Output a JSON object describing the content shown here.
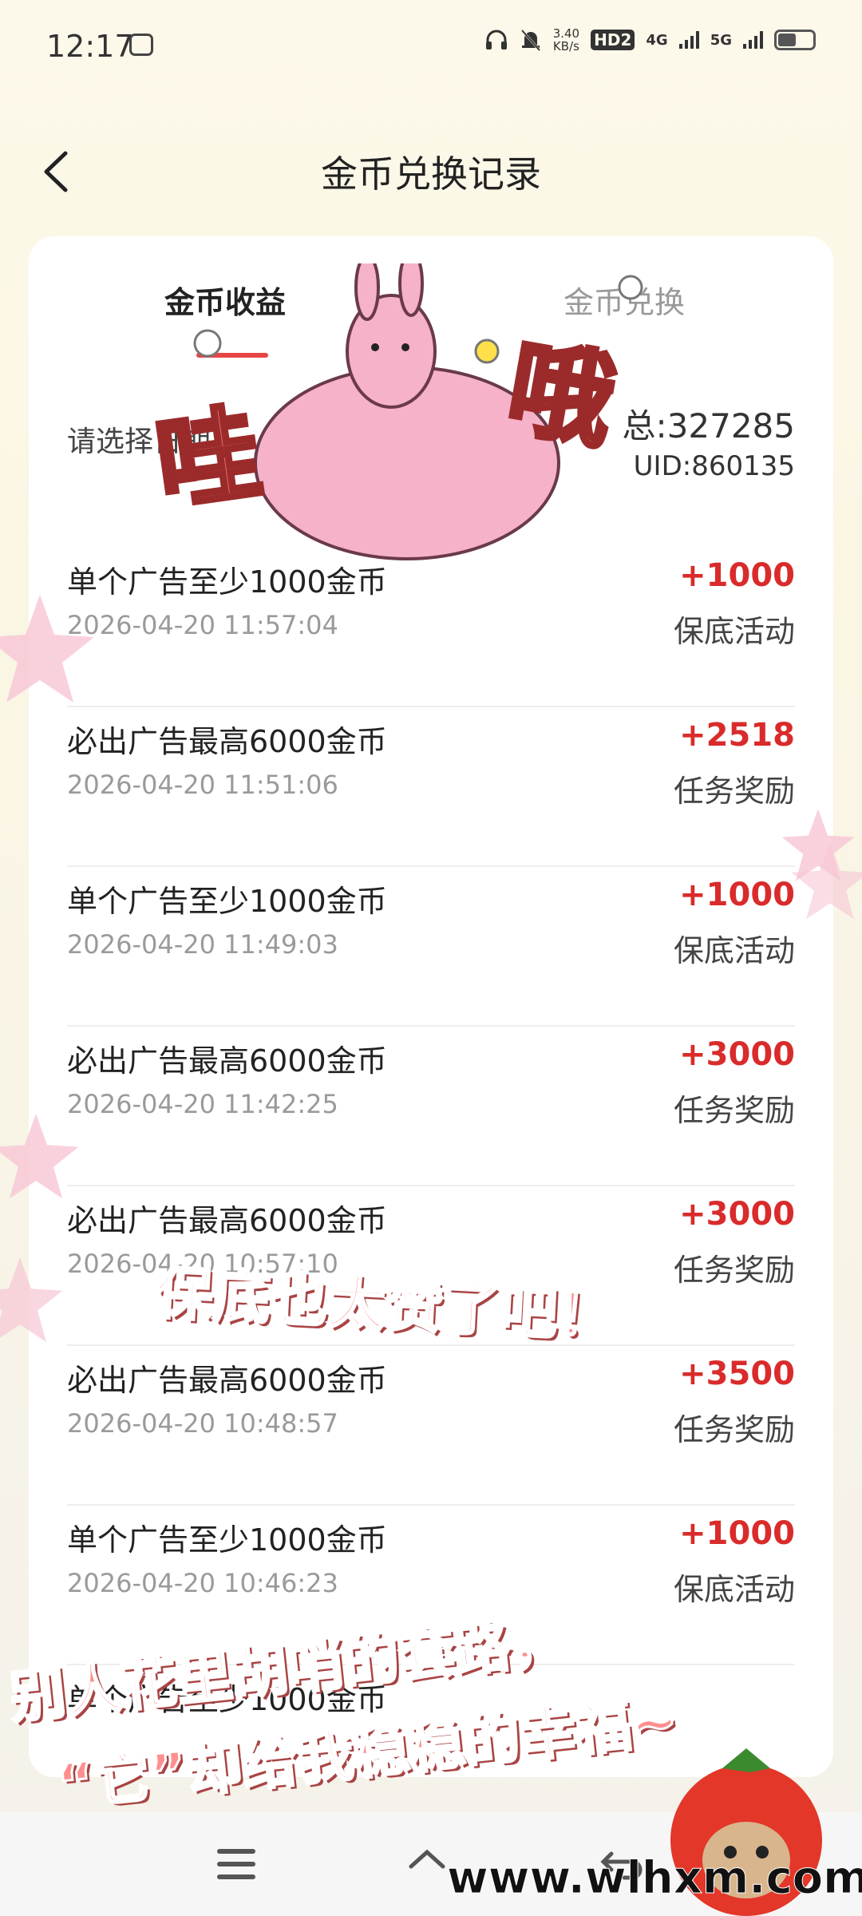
{
  "status_bar": {
    "time": "12:17",
    "speed_value": "3.40",
    "speed_unit": "KB/s",
    "hd_badge": "HD2",
    "signal_4g": "4G",
    "signal_5g": "5G"
  },
  "header": {
    "title": "金币兑换记录",
    "back_icon": "chevron-left-icon"
  },
  "tabs": [
    {
      "label": "金币收益",
      "active": true
    },
    {
      "label": "金币兑换",
      "active": false
    }
  ],
  "filter": {
    "label": "请选择日期"
  },
  "summary": {
    "total": "总:327285",
    "uid": "UID:860135"
  },
  "records": [
    {
      "title": "单个广告至少1000金币",
      "time": "2026-04-20 11:57:04",
      "amount": "+1000",
      "type": "保底活动"
    },
    {
      "title": "必出广告最高6000金币",
      "time": "2026-04-20 11:51:06",
      "amount": "+2518",
      "type": "任务奖励"
    },
    {
      "title": "单个广告至少1000金币",
      "time": "2026-04-20 11:49:03",
      "amount": "+1000",
      "type": "保底活动"
    },
    {
      "title": "必出广告最高6000金币",
      "time": "2026-04-20 11:42:25",
      "amount": "+3000",
      "type": "任务奖励"
    },
    {
      "title": "必出广告最高6000金币",
      "time": "2026-04-20 10:57:10",
      "amount": "+3000",
      "type": "任务奖励"
    },
    {
      "title": "必出广告最高6000金币",
      "time": "2026-04-20 10:48:57",
      "amount": "+3500",
      "type": "任务奖励"
    },
    {
      "title": "单个广告至少1000金币",
      "time": "2026-04-20 10:46:23",
      "amount": "+1000",
      "type": "保底活动"
    },
    {
      "title": "单个广告至少1000金币",
      "time": "",
      "amount": "",
      "type": ""
    }
  ],
  "overlays": {
    "sticker_left": "哇",
    "sticker_right": "哦",
    "caption_mid": "保底也太赞了吧！",
    "caption_line1": "别人花里胡哨的套路，",
    "caption_line2": "“它”却给我稳稳的幸福~",
    "watermark": "www.wlhxm.com"
  },
  "colors": {
    "accent": "#e74446",
    "amount": "#d92b2b",
    "background": "#fdf9ea"
  }
}
